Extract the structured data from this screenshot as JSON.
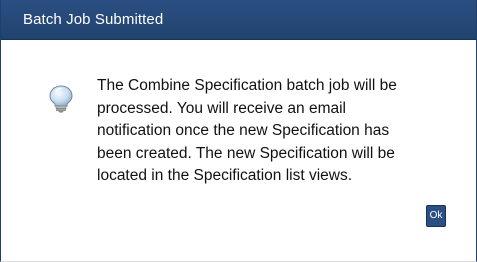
{
  "dialog": {
    "title": "Batch Job Submitted",
    "icon": "lightbulb-icon",
    "message_lines": [
      "The Combine Specification batch job will be",
      "processed. You will receive an email",
      "notification once the new Specification has",
      "been created. The new Specification will be",
      "located in the Specification list views."
    ],
    "ok_label": "Ok"
  },
  "colors": {
    "titlebar": "#2a4f82",
    "button": "#2a4f82",
    "text": "#111111"
  }
}
